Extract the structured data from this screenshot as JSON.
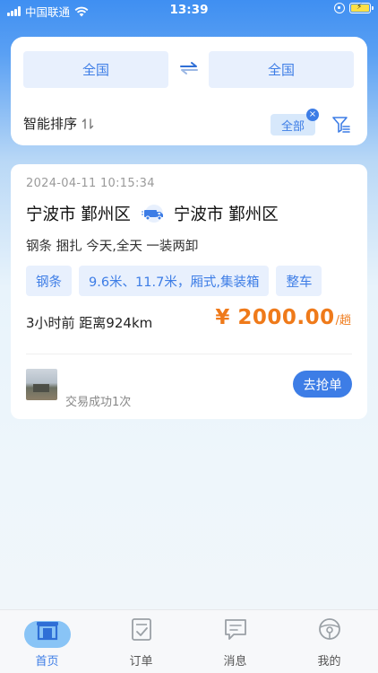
{
  "status_bar": {
    "carrier": "中国联通",
    "time": "13:39"
  },
  "search": {
    "from": "全国",
    "to": "全国",
    "sort_label": "智能排序",
    "filter_tag": "全部",
    "filter_tag_close": "×"
  },
  "order": {
    "time": "2024-04-11 10:15:34",
    "origin": "宁波市 鄞州区",
    "destination": "宁波市 鄞州区",
    "description": "钢条 捆扎 今天,全天 一装两卸",
    "chips": [
      "钢条",
      "9.6米、11.7米，厢式,集装箱",
      "整车"
    ],
    "distance_text": "3小时前 距离924km",
    "price": "¥ 2000.00",
    "price_unit": "/趟",
    "success_text": "交易成功1次",
    "grab_button": "去抢单"
  },
  "tabs": [
    {
      "label": "首页",
      "icon": "home-icon",
      "active": true
    },
    {
      "label": "订单",
      "icon": "order-icon",
      "active": false
    },
    {
      "label": "消息",
      "icon": "message-icon",
      "active": false
    },
    {
      "label": "我的",
      "icon": "steering-wheel-icon",
      "active": false
    }
  ],
  "colors": {
    "accent": "#3d7de6",
    "price": "#ef7a1a",
    "chip_bg": "#e8f0fd"
  }
}
